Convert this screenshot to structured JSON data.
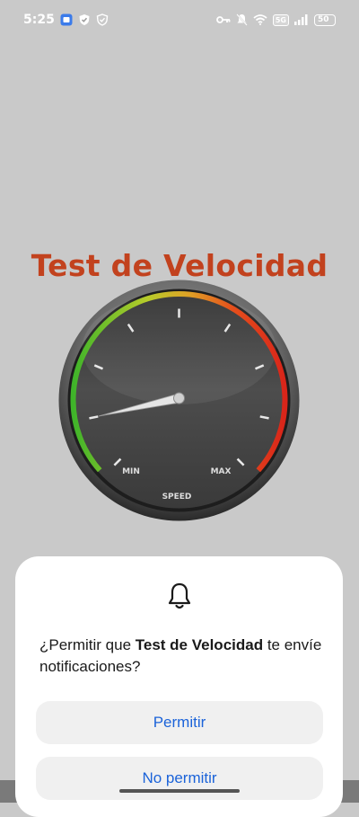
{
  "status_bar": {
    "time": "5:25",
    "data_badge": "5G",
    "battery": "50"
  },
  "app": {
    "title": "Test de Velocidad",
    "gauge": {
      "min_label": "MIN",
      "max_label": "MAX",
      "center_label": "SPEED",
      "needle_level_fraction": 0.12,
      "arc_colors": [
        "#3fb42a",
        "#b7cc2a",
        "#e0a126",
        "#e5501c",
        "#d8251a"
      ]
    }
  },
  "dialog": {
    "prompt_prefix": "¿Permitir que ",
    "app_name": "Test de Velocidad",
    "prompt_suffix": " te envíe notificaciones?",
    "allow_label": "Permitir",
    "deny_label": "No permitir",
    "accent": "#1b63d9"
  }
}
